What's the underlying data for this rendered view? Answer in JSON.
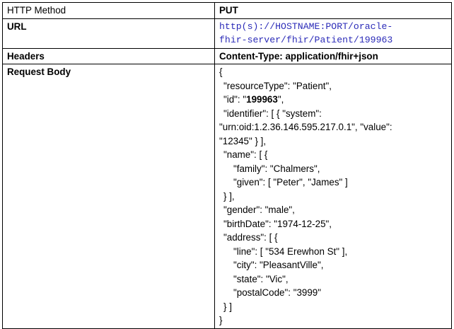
{
  "rows": {
    "method": {
      "label": "HTTP Method",
      "value": "PUT"
    },
    "url": {
      "label": "URL",
      "line1": "http(s)://HOSTNAME:PORT/oracle-",
      "line2": "fhir-server/fhir/Patient/199963"
    },
    "headers": {
      "label": "Headers",
      "value": "Content-Type: application/fhir+json"
    },
    "body": {
      "label": "Request Body",
      "lines": {
        "l1": "{",
        "l2": "\"resourceType\": \"Patient\",",
        "l3a": "\"id\": \"",
        "l3b": "199963",
        "l3c": "\",",
        "l4": "\"identifier\": [ { \"system\":",
        "l5": "\"urn:oid:1.2.36.146.595.217.0.1\", \"value\":",
        "l6": "\"12345\" } ],",
        "l7": "\"name\": [ {",
        "l8": "\"family\": \"Chalmers\",",
        "l9": "\"given\": [ \"Peter\", \"James\" ]",
        "l10": "} ],",
        "l11": "\"gender\": \"male\",",
        "l12": "\"birthDate\": \"1974-12-25\",",
        "l13": "\"address\": [ {",
        "l14": "\"line\": [ \"534 Erewhon St\" ],",
        "l15": "\"city\": \"PleasantVille\",",
        "l16": "\"state\": \"Vic\",",
        "l17": "\"postalCode\": \"3999\"",
        "l18": "} ]",
        "l19": "}"
      }
    }
  }
}
